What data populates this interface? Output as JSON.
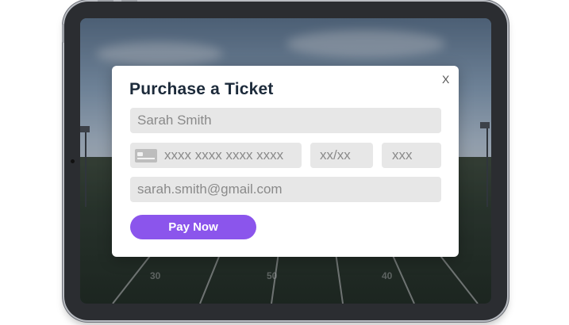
{
  "modal": {
    "title": "Purchase a Ticket",
    "close_label": "X",
    "name_value": "Sarah Smith",
    "card_number_placeholder": "xxxx xxxx xxxx xxxx",
    "expiry_placeholder": "xx/xx",
    "cvv_placeholder": "xxx",
    "email_value": "sarah.smith@gmail.com",
    "pay_label": "Pay Now"
  },
  "background": {
    "yard_numbers": [
      "30",
      "50",
      "40"
    ]
  },
  "colors": {
    "accent": "#8b55ec",
    "title": "#1c2a3a",
    "field_bg": "#e7e7e7"
  }
}
